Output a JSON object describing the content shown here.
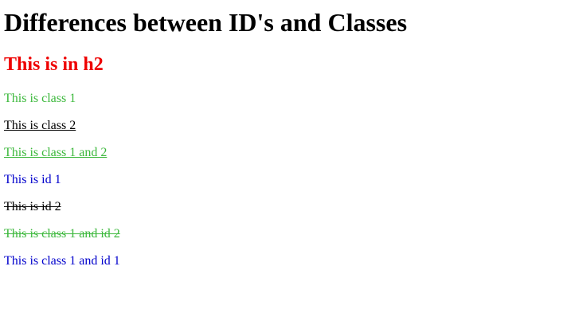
{
  "heading": "Differences between ID's and Classes",
  "subheading": "This is in h2",
  "colors": {
    "h2": "#ee0000",
    "class1": "#3cb83c",
    "id1": "#0000cc",
    "default": "#000000"
  },
  "lines": [
    {
      "text": "This is class 1",
      "color": "#3cb83c",
      "decoration": "none"
    },
    {
      "text": "This is class 2",
      "color": "#000000",
      "decoration": "underline"
    },
    {
      "text": "This is class 1 and 2",
      "color": "#3cb83c",
      "decoration": "underline"
    },
    {
      "text": "This is id 1",
      "color": "#0000cc",
      "decoration": "none"
    },
    {
      "text": "This is id 2",
      "color": "#000000",
      "decoration": "line-through"
    },
    {
      "text": "This is class 1 and id 2",
      "color": "#3cb83c",
      "decoration": "line-through"
    },
    {
      "text": "This is class 1 and id 1",
      "color": "#0000cc",
      "decoration": "none"
    }
  ]
}
